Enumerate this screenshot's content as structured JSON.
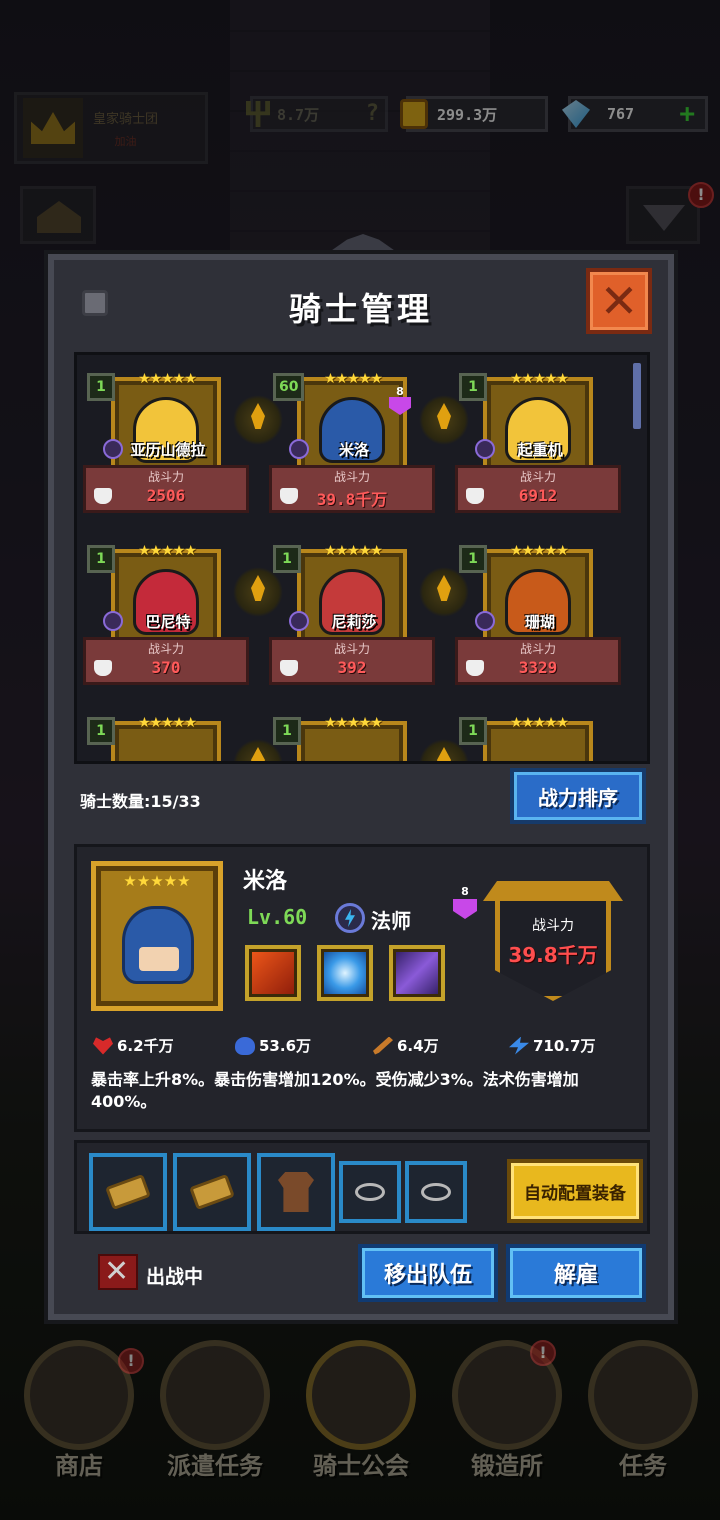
{
  "hud": {
    "guild_name": "皇家骑士团",
    "guild_sub": "加油",
    "power": "8.7万",
    "power_help": "?",
    "gold": "299.3万",
    "gems": "767",
    "gems_add": "+"
  },
  "notifications": {
    "top_right": "!",
    "shop": "!",
    "forge": "!"
  },
  "panel": {
    "title": "骑士管理",
    "close_label": "✕",
    "knight_count_label": "骑士数量:",
    "knight_count": "15/33",
    "sort_label": "战力排序"
  },
  "knights": [
    {
      "level": "1",
      "name": "亚历山德拉",
      "power_label": "战斗力",
      "power": "2506",
      "stars": "★★★★★",
      "hair": "#f2c43a"
    },
    {
      "level": "60",
      "name": "米洛",
      "power_label": "战斗力",
      "power": "39.8千万",
      "stars": "★★★★★",
      "hair": "#2a5aa8",
      "badge": "8"
    },
    {
      "level": "1",
      "name": "起重机",
      "power_label": "战斗力",
      "power": "6912",
      "stars": "★★★★★",
      "hair": "#f2c43a"
    },
    {
      "level": "1",
      "name": "巴尼特",
      "power_label": "战斗力",
      "power": "370",
      "stars": "★★★★★",
      "hair": "#c42a3a"
    },
    {
      "level": "1",
      "name": "尼莉莎",
      "power_label": "战斗力",
      "power": "392",
      "stars": "★★★★★",
      "hair": "#c43a3a"
    },
    {
      "level": "1",
      "name": "珊瑚",
      "power_label": "战斗力",
      "power": "3329",
      "stars": "★★★★★",
      "hair": "#c85a1a"
    },
    {
      "level": "1",
      "stars": "★★★★★"
    },
    {
      "level": "1",
      "stars": "★★★★★"
    },
    {
      "level": "1",
      "stars": "★★★★★"
    }
  ],
  "selected": {
    "stars": "★★★★★",
    "name": "米洛",
    "level": "Lv.60",
    "class": "法师",
    "badge": "8",
    "power_label": "战斗力",
    "power": "39.8千万",
    "stats": {
      "hp": "6.2千万",
      "mp": "53.6万",
      "atk": "6.4万",
      "magic": "710.7万"
    },
    "description": "暴击率上升8%。暴击伤害增加120%。受伤减少3%。法术伤害增加400%。",
    "skills": [
      "fire-skill",
      "vortex-skill",
      "lightning-skill"
    ]
  },
  "equipment": {
    "slots": [
      "scroll",
      "scroll",
      "armor",
      "ring",
      "ring"
    ],
    "auto_label": "自动配置装备"
  },
  "actions": {
    "deploy_status": "出战中",
    "remove_label": "移出队伍",
    "dismiss_label": "解雇"
  },
  "bottom_nav": [
    {
      "label": "商店"
    },
    {
      "label": "派遣任务"
    },
    {
      "label": "骑士公会"
    },
    {
      "label": "锻造所"
    },
    {
      "label": "任务"
    }
  ]
}
